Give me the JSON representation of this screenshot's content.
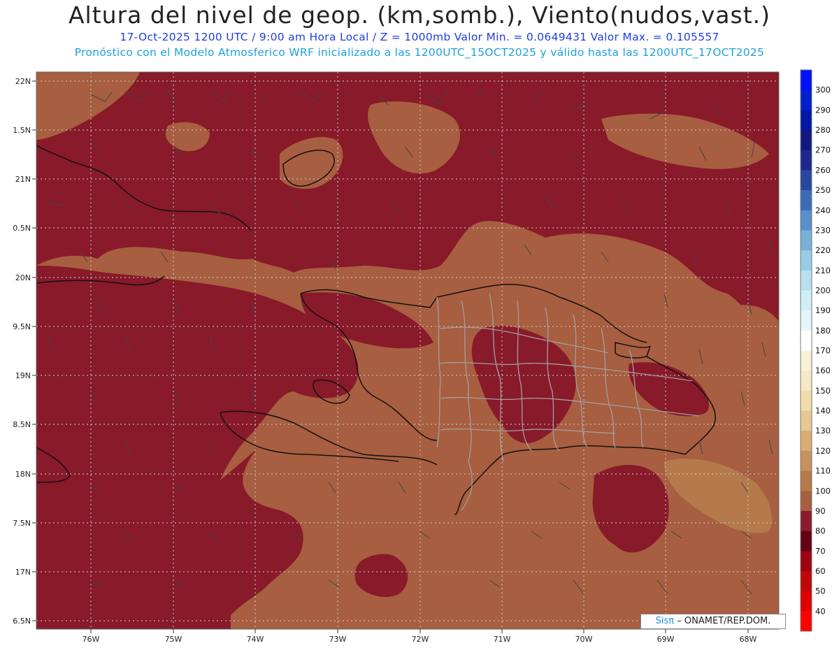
{
  "title": "Altura del nivel de geop. (km,somb.), Viento(nudos,vast.)",
  "subtitle_line1": "17-Oct-2025  1200 UTC / 9:00 am Hora Local / Z = 1000mb  Valor Min. = 0.0649431  Valor Max. = 0.105557",
  "subtitle_line2": "Pronóstico con el Modelo Atmosferico WRF inicializado a las 1200UTC_15OCT2025 y válido hasta las  1200UTC_17OCT2025",
  "lat_labels": [
    "22N",
    "1.5N",
    "21N",
    "0.5N",
    "20N",
    "9.5N",
    "19N",
    "8.5N",
    "18N",
    "7.5N",
    "17N",
    "6.5N"
  ],
  "lon_labels": [
    "76W",
    "75W",
    "74W",
    "73W",
    "72W",
    "71W",
    "70W",
    "69W",
    "68W"
  ],
  "colorbar": {
    "labels": [
      "300",
      "290",
      "280",
      "270",
      "260",
      "250",
      "240",
      "230",
      "220",
      "210",
      "200",
      "190",
      "180",
      "170",
      "160",
      "150",
      "140",
      "130",
      "120",
      "110",
      "100",
      "90",
      "80",
      "70",
      "60",
      "50",
      "40"
    ],
    "colors": [
      "#0010ff",
      "#0020d0",
      "#0018a8",
      "#101880",
      "#1c2890",
      "#2848a0",
      "#3c6cb8",
      "#5890c8",
      "#78b0d8",
      "#98cce4",
      "#b8e0ee",
      "#d0eef6",
      "#e4f6fa",
      "#ffffff",
      "#fbf2d6",
      "#f6e8c4",
      "#f0dcaa",
      "#e8c890",
      "#d9ac72",
      "#c8925c",
      "#b7784a",
      "#a85e40",
      "#8c1c2c",
      "#640018",
      "#a00010",
      "#c00808",
      "#e00000",
      "#ff0000"
    ]
  },
  "map_colors": {
    "low": "#881a2a",
    "mid": "#a85e40",
    "high": "#b47a4c",
    "coast": "#111111",
    "provinces": "#a0a0a0",
    "grid": "#d0d0d0"
  },
  "credit": {
    "brand": "Sisπ",
    "org": "– ONAMET/REP.DOM."
  }
}
